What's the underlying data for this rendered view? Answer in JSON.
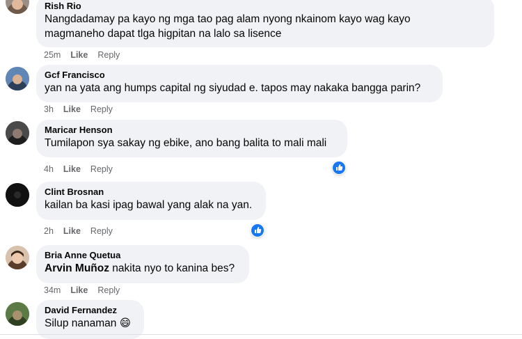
{
  "comments": [
    {
      "author": "Rish Rio",
      "lines": [
        "Nangdadamay pa kayo ng mga tao pag alam nyong nkainom kayo wag kayo",
        "magmaneho dapat tlga higpitan na lalo sa lisence"
      ],
      "time": "25m",
      "like": "Like",
      "reply": "Reply"
    },
    {
      "author": "Gcf Francisco",
      "lines": [
        "yan na yata ang humps capital ng siyudad e. tapos may nakaka bangga parin?"
      ],
      "time": "3h",
      "like": "Like",
      "reply": "Reply"
    },
    {
      "author": "Maricar Henson",
      "lines": [
        "Tumilapon sya sakay ng ebike, ano bang balita to mali mali"
      ],
      "time": "4h",
      "like": "Like",
      "reply": "Reply",
      "reaction": "like-reaction-icon"
    },
    {
      "author": "Clint Brosnan",
      "lines": [
        "kailan ba kasi ipag bawal yang alak na yan."
      ],
      "time": "2h",
      "like": "Like",
      "reply": "Reply",
      "reaction": "like-reaction-icon"
    },
    {
      "author": "Bria Anne Quetua",
      "mention": "Arvin Muñoz",
      "text": " nakita nyo to kanina bes?",
      "time": "34m",
      "like": "Like",
      "reply": "Reply"
    },
    {
      "author": "David Fernandez",
      "text": "Silup nanaman ",
      "emoji": "😄"
    }
  ],
  "colors": {
    "bubble": "#f0f2f5",
    "meta": "#65676b",
    "like_blue": "#1877f2"
  }
}
